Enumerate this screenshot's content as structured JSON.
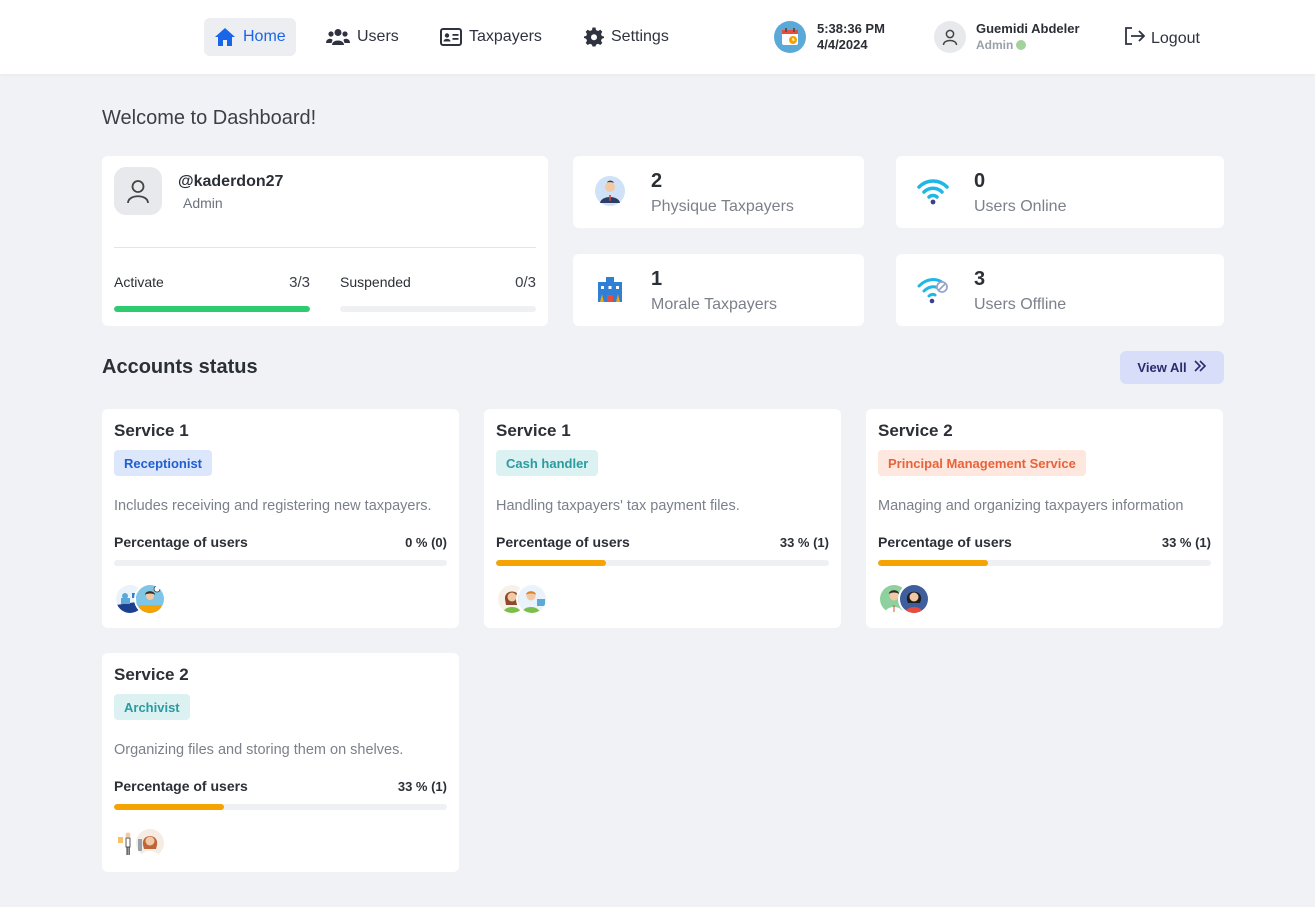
{
  "nav": {
    "items": [
      {
        "label": "Home",
        "icon": "home-icon"
      },
      {
        "label": "Users",
        "icon": "users-icon"
      },
      {
        "label": "Taxpayers",
        "icon": "id-card-icon"
      },
      {
        "label": "Settings",
        "icon": "gear-icon"
      }
    ],
    "time": "5:38:36 PM",
    "date": "4/4/2024",
    "user_name": "Guemidi Abdeler",
    "user_role": "Admin",
    "logout_label": "Logout"
  },
  "page": {
    "welcome": "Welcome to Dashboard!"
  },
  "profile": {
    "handle": "@kaderdon27",
    "role": "Admin",
    "activate_label": "Activate",
    "activate_count": "3/3",
    "activate_fraction": 1.0,
    "suspended_label": "Suspended",
    "suspended_count": "0/3",
    "suspended_fraction": 0.0
  },
  "stats": [
    {
      "value": "2",
      "label": "Physique Taxpayers",
      "icon": "person-taxpayer-icon"
    },
    {
      "value": "0",
      "label": "Users Online",
      "icon": "wifi-icon"
    },
    {
      "value": "1",
      "label": "Morale Taxpayers",
      "icon": "building-icon"
    },
    {
      "value": "3",
      "label": "Users Offline",
      "icon": "wifi-off-icon"
    }
  ],
  "accounts": {
    "title": "Accounts status",
    "view_all_label": "View All",
    "services": [
      {
        "title": "Service 1",
        "badge": "Receptionist",
        "badge_bg": "#dde7fb",
        "badge_fg": "#1f5fcf",
        "description": "Includes receiving and registering new taxpayers.",
        "pct_label": "Percentage of users",
        "pct_value": "0 % (0)",
        "fraction": 0.0
      },
      {
        "title": "Service 1",
        "badge": "Cash handler",
        "badge_bg": "#dcf1f1",
        "badge_fg": "#2a9ba0",
        "description": "Handling taxpayers' tax payment files.",
        "pct_label": "Percentage of users",
        "pct_value": "33 % (1)",
        "fraction": 0.33
      },
      {
        "title": "Service 2",
        "badge": "Principal Management Service",
        "badge_bg": "#fde7df",
        "badge_fg": "#e8633a",
        "description": "Managing and organizing taxpayers information",
        "pct_label": "Percentage of users",
        "pct_value": "33 % (1)",
        "fraction": 0.33
      },
      {
        "title": "Service 2",
        "badge": "Archivist",
        "badge_bg": "#dcf1f1",
        "badge_fg": "#2a9ba0",
        "description": "Organizing files and storing them on shelves.",
        "pct_label": "Percentage of users",
        "pct_value": "33 % (1)",
        "fraction": 0.33
      }
    ]
  },
  "colors": {
    "accent": "#1a66e8",
    "progress_green": "#2ecc71",
    "progress_orange": "#f5a300"
  }
}
